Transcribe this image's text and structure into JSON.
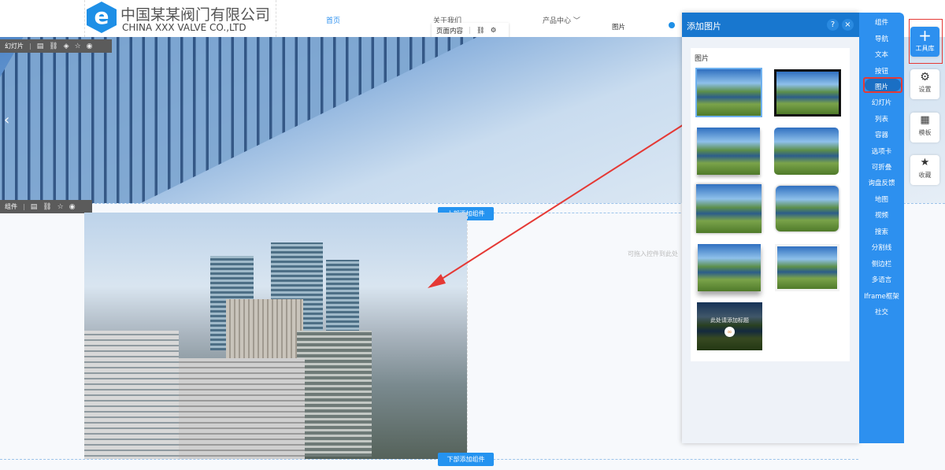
{
  "header": {
    "logo_cn": "中国某某阀门有限公司",
    "logo_en": "CHINA XXX VALVE CO.,LTD",
    "logo_letter": "e",
    "nav": [
      "首页",
      "关于我们",
      "产品中心"
    ]
  },
  "page_content_bar": {
    "label": "页面内容"
  },
  "selected_tag": "图片",
  "slideshow_toolbar": {
    "label": "幻灯片"
  },
  "component_toolbar": {
    "label": "组件"
  },
  "add_top": "上部添加组件",
  "add_bottom": "下部添加组件",
  "drop_hint": "可拖入控件到此处",
  "panel": {
    "title": "添加图片",
    "help": "?",
    "close": "×",
    "section": "图片",
    "caption_card_text": "此处请添加标题"
  },
  "sidenav": [
    "组件",
    "导航",
    "文本",
    "按钮",
    "图片",
    "幻灯片",
    "列表",
    "容器",
    "选项卡",
    "可折叠",
    "询盘反馈",
    "地图",
    "视频",
    "搜索",
    "分割线",
    "侧边栏",
    "多语言",
    "Iframe框架",
    "社交"
  ],
  "tools": [
    "工具库",
    "设置",
    "模板",
    "收藏"
  ],
  "colors": {
    "accent": "#2d90ef",
    "panel_head": "#1877cf",
    "highlight": "#e53935"
  }
}
